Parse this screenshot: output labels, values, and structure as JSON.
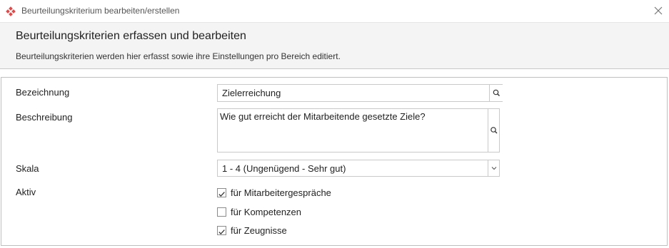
{
  "window": {
    "title": "Beurteilungskriterium bearbeiten/erstellen",
    "icon": "red-diamond-app-icon",
    "close_icon": "close-icon"
  },
  "header": {
    "title": "Beurteilungskriterien erfassen und bearbeiten",
    "description": "Beurteilungskriterien werden hier erfasst sowie ihre Einstellungen pro Bereich editiert."
  },
  "form": {
    "bezeichnung": {
      "label": "Bezeichnung",
      "value": "Zielerreichung"
    },
    "beschreibung": {
      "label": "Beschreibung",
      "value": "Wie gut erreicht der Mitarbeitende gesetzte Ziele?"
    },
    "skala": {
      "label": "Skala",
      "value": "1 - 4 (Ungenügend  - Sehr gut)"
    },
    "aktiv": {
      "label": "Aktiv",
      "options": [
        {
          "label": "für Mitarbeitergespräche",
          "checked": true
        },
        {
          "label": "für Kompetenzen",
          "checked": false
        },
        {
          "label": "für Zeugnisse",
          "checked": true
        }
      ]
    }
  },
  "colors": {
    "accent": "#e04a4a",
    "header_bg": "#f4f4f4",
    "border": "#c9c9c9"
  }
}
